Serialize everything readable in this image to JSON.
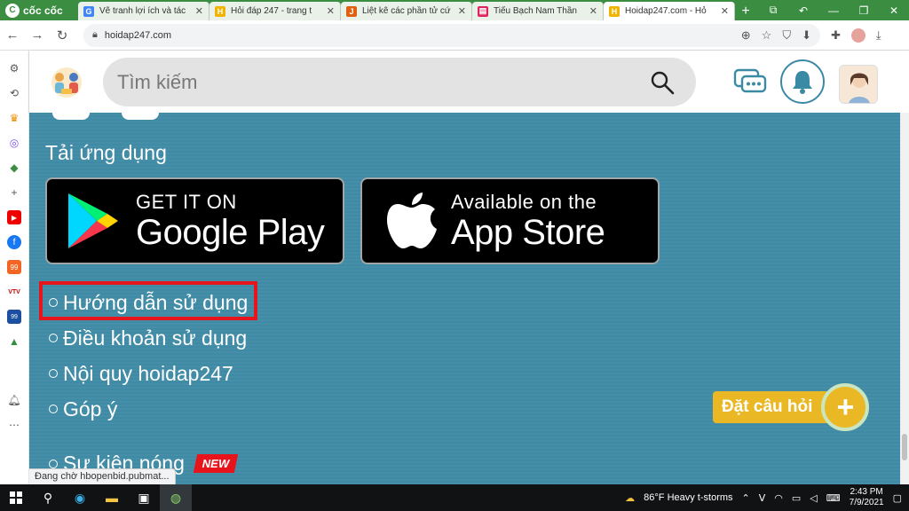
{
  "browser": {
    "brand": "cốc cốc",
    "tabs": [
      {
        "title": "Vẽ tranh lợi ích và tác",
        "favicon": "G",
        "favicon_color": "#4285f4",
        "active": false
      },
      {
        "title": "Hỏi đáp 247 - trang t",
        "favicon": "H",
        "favicon_color": "#f2b200",
        "active": false
      },
      {
        "title": "Liệt kê các phần tử cứ",
        "favicon": "J",
        "favicon_color": "#e06010",
        "active": false
      },
      {
        "title": "Tiểu Bạch Nam Thần",
        "favicon": "▤",
        "favicon_color": "#e0245e",
        "active": false
      },
      {
        "title": "Hoidap247.com - Hỏ",
        "favicon": "H",
        "favicon_color": "#f2b200",
        "active": true
      }
    ],
    "url": "hoidap247.com",
    "status_text": "Đang chờ hbopenbid.pubmat..."
  },
  "header": {
    "search_placeholder": "Tìm kiếm"
  },
  "footer": {
    "apps_title": "Tải ứng dụng",
    "google_play": {
      "line1": "GET IT ON",
      "line2": "Google Play"
    },
    "app_store": {
      "line1": "Available on the",
      "line2": "App Store"
    },
    "links": [
      {
        "label": "Hướng dẫn sử dụng",
        "highlighted": true
      },
      {
        "label": "Điều khoản sử dụng",
        "highlighted": false
      },
      {
        "label": "Nội quy hoidap247",
        "highlighted": false
      },
      {
        "label": "Góp ý",
        "highlighted": false
      }
    ],
    "hot_events": "Sự kiện nóng",
    "new_badge": "NEW",
    "ask_button": "Đặt câu hỏi",
    "ask_plus": "+"
  },
  "taskbar": {
    "weather": "86°F  Heavy t-storms",
    "time": "2:43 PM",
    "date": "7/9/2021"
  },
  "colors": {
    "browser_green": "#3b8d41",
    "footer_teal": "#3f8aa5",
    "highlight_red": "#e8141c",
    "ask_yellow": "#e9b824"
  }
}
